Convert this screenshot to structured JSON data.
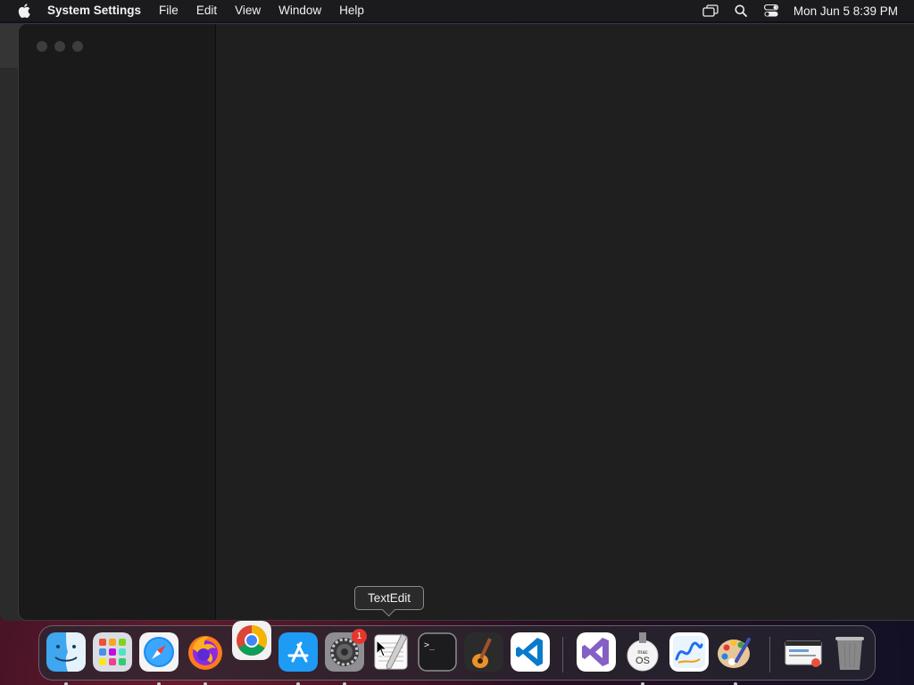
{
  "menubar": {
    "app_name": "System Settings",
    "menus": [
      "File",
      "Edit",
      "View",
      "Window",
      "Help"
    ],
    "clock": "Mon Jun 5  8:39 PM",
    "status_icons": [
      "screen-mirroring-icon",
      "search-icon",
      "control-center-icon"
    ]
  },
  "tooltip": {
    "text": "TextEdit"
  },
  "dock": {
    "apps": [
      {
        "name": "Finder",
        "icon": "finder-icon",
        "running": true
      },
      {
        "name": "Launchpad",
        "icon": "launchpad-icon",
        "running": false
      },
      {
        "name": "Safari",
        "icon": "safari-icon",
        "running": true
      },
      {
        "name": "Firefox",
        "icon": "firefox-icon",
        "running": true
      },
      {
        "name": "Google Chrome",
        "icon": "chrome-icon",
        "running": false
      },
      {
        "name": "App Store",
        "icon": "app-store-icon",
        "running": true
      },
      {
        "name": "System Settings",
        "icon": "settings-gear-icon",
        "running": true,
        "badge": "1"
      },
      {
        "name": "TextEdit",
        "icon": "textedit-icon",
        "running": false
      },
      {
        "name": "Terminal",
        "icon": "terminal-icon",
        "running": false
      },
      {
        "name": "GarageBand",
        "icon": "garageband-icon",
        "running": false
      },
      {
        "name": "Visual Studio Code",
        "icon": "vscode-icon",
        "running": false
      },
      {
        "name": "Visual Studio",
        "icon": "visual-studio-icon",
        "running": false
      },
      {
        "name": "macOS Installer",
        "icon": "macos-installer-icon",
        "running": true
      },
      {
        "name": "Freeform",
        "icon": "freeform-icon",
        "running": false
      },
      {
        "name": "Paintbrush",
        "icon": "paint-palette-icon",
        "running": true
      },
      {
        "name": "Downloads",
        "icon": "downloads-stack-icon",
        "running": false
      },
      {
        "name": "Trash",
        "icon": "trash-icon",
        "running": false
      }
    ]
  }
}
